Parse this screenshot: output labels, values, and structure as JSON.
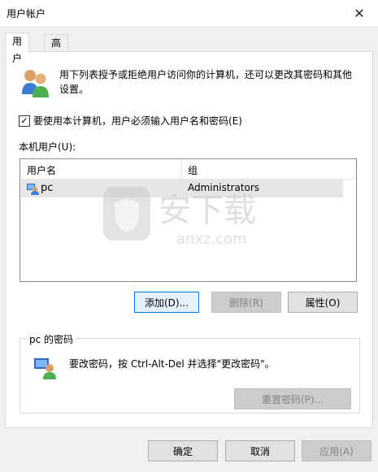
{
  "window": {
    "title": "用户帐户",
    "close_glyph": "✕"
  },
  "tabs": [
    {
      "label": "用户",
      "active": true
    },
    {
      "label": "高级",
      "active": false
    }
  ],
  "intro_text": "用下列表授予或拒绝用户访问你的计算机，还可以更改其密码和其他设置。",
  "require_login": {
    "label": "要使用本计算机，用户必须输入用户名和密码(E)",
    "checked": true,
    "check_glyph": "✓"
  },
  "local_users_label": "本机用户(U):",
  "table": {
    "columns": [
      "用户名",
      "组"
    ],
    "rows": [
      {
        "name": "pc",
        "group": "Administrators"
      }
    ]
  },
  "watermark": {
    "text": "安下载",
    "subtext": "anxz.com"
  },
  "buttons": {
    "add": "添加(D)...",
    "remove": "删除(R)",
    "properties": "属性(O)"
  },
  "password_group": {
    "title": "pc 的密码",
    "text": "要改密码，按 Ctrl-Alt-Del 并选择\"更改密码\"。",
    "reset_button": "重置密码(P)..."
  },
  "footer": {
    "ok": "确定",
    "cancel": "取消",
    "apply": "应用(A)"
  }
}
